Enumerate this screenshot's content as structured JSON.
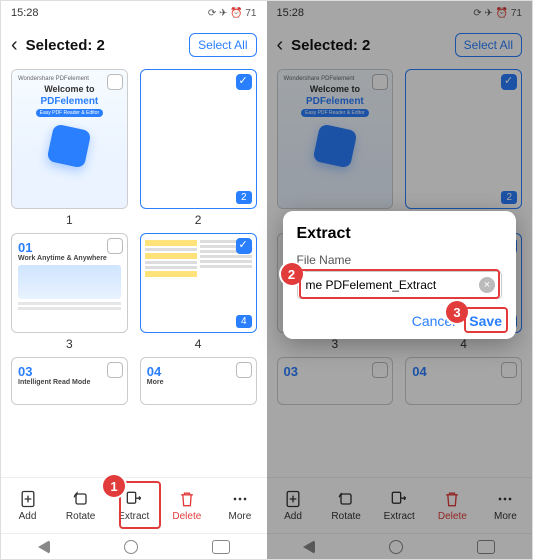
{
  "status": {
    "time": "15:28",
    "icons": "⟳ ✈ ⏰ 71"
  },
  "header": {
    "title": "Selected: 2",
    "select_all": "Select All"
  },
  "pages": {
    "p1": {
      "num": "1",
      "welcome_l1": "Welcome to",
      "welcome_l2": "PDFelement",
      "brand": "Wondershare PDFelement",
      "pill": "Easy PDF Reader & Editor"
    },
    "p2": {
      "num": "2",
      "badge": "2"
    },
    "p3": {
      "num": "3",
      "n": "01",
      "tt": "Work Anytime & Anywhere"
    },
    "p4": {
      "num": "4",
      "badge": "4"
    },
    "p5": {
      "n": "03",
      "tt": "Intelligent Read Mode"
    },
    "p6": {
      "n": "04",
      "tt": "More"
    }
  },
  "toolbar": {
    "add": "Add",
    "rotate": "Rotate",
    "extract": "Extract",
    "delete": "Delete",
    "more": "More"
  },
  "annotations": {
    "a1": "1",
    "a2": "2",
    "a3": "3"
  },
  "modal": {
    "title": "Extract",
    "label": "File Name",
    "value": "me PDFelement_Extract",
    "cancel": "Cancel",
    "save": "Save"
  }
}
